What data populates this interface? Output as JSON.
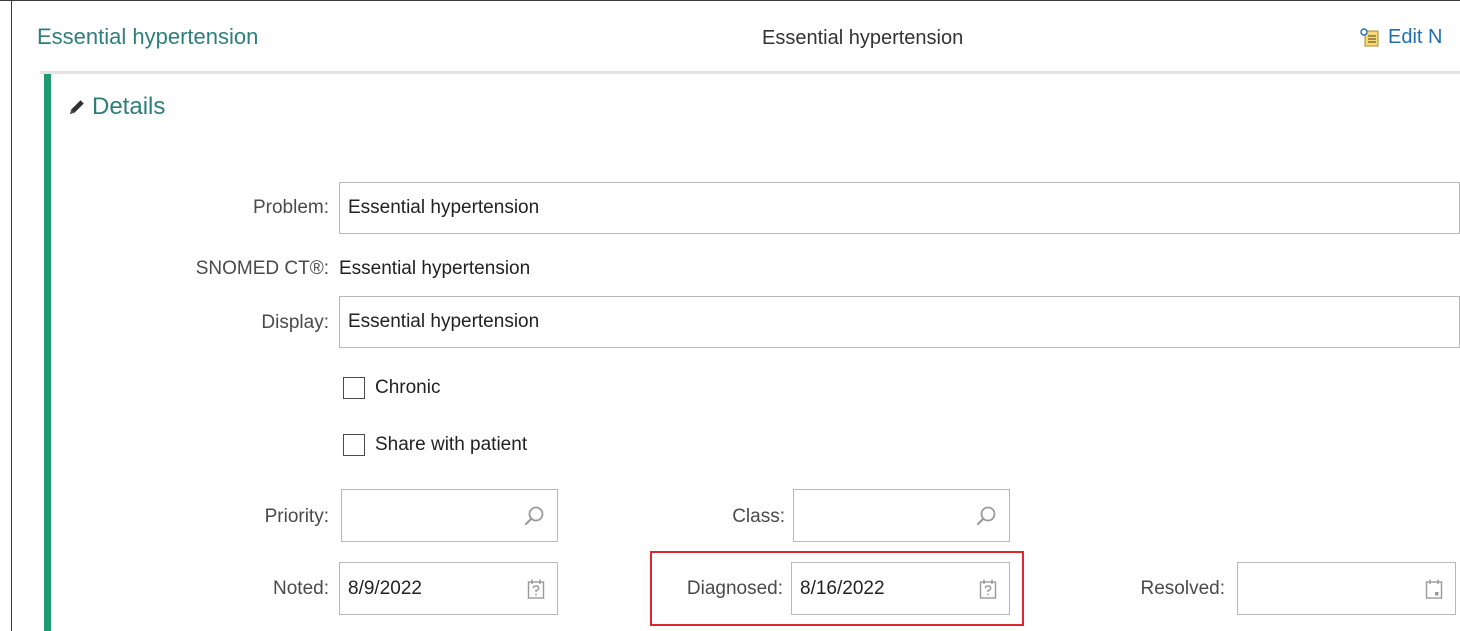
{
  "header": {
    "title": "Essential hypertension",
    "center_title": "Essential hypertension",
    "edit_label": "Edit N"
  },
  "details": {
    "title": "Details",
    "problem_label": "Problem:",
    "problem_value": "Essential hypertension",
    "snomed_label": "SNOMED CT®:",
    "snomed_value": "Essential hypertension",
    "display_label": "Display:",
    "display_value": "Essential hypertension",
    "chronic_label": "Chronic",
    "chronic_checked": false,
    "share_label": "Share with patient",
    "share_checked": false,
    "priority_label": "Priority:",
    "priority_value": "",
    "class_label": "Class:",
    "class_value": "",
    "noted_label": "Noted:",
    "noted_value": "8/9/2022",
    "diagnosed_label": "Diagnosed:",
    "diagnosed_value": "8/16/2022",
    "resolved_label": "Resolved:",
    "resolved_value": ""
  },
  "colors": {
    "accent_teal": "#2e7f7a",
    "accent_green_bar": "#1c9b73",
    "link_blue": "#1f6fb2",
    "highlight_red": "#e0252c"
  },
  "icons": [
    "pencil-icon",
    "edit-notes-icon",
    "search-icon",
    "calendar-unknown-icon",
    "calendar-icon"
  ]
}
